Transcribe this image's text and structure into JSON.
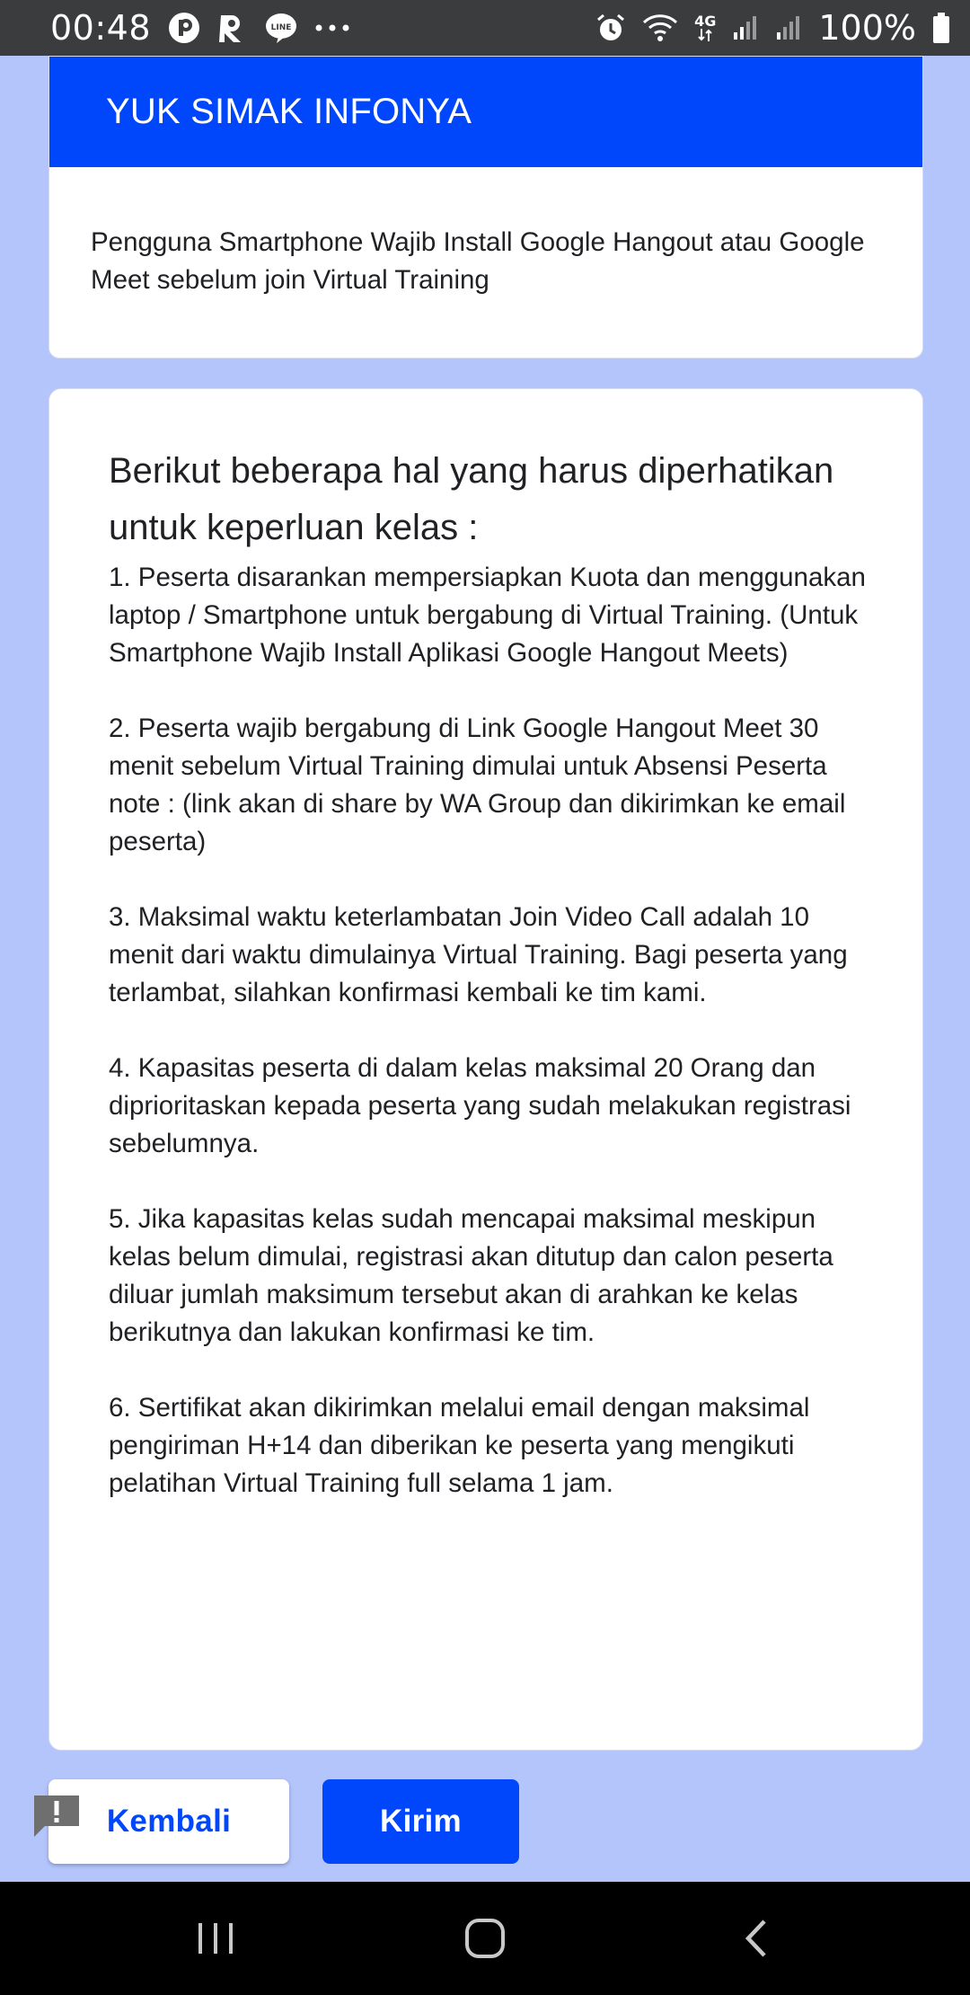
{
  "status_bar": {
    "time": "00:48",
    "network": "4G",
    "battery": "100%",
    "notification_icons": [
      "p-app-icon",
      "r-app-icon",
      "line-icon",
      "more-dots-icon"
    ],
    "system_icons": [
      "alarm-icon",
      "wifi-icon",
      "signal-icon",
      "signal-icon",
      "battery-icon"
    ]
  },
  "header": {
    "title": "YUK SIMAK INFONYA",
    "description": "Pengguna Smartphone Wajib Install Google Hangout atau Google Meet sebelum join Virtual Training"
  },
  "info": {
    "title": "Berikut beberapa hal yang harus diperhatikan untuk keperluan kelas :",
    "body": "1. Peserta disarankan mempersiapkan Kuota dan menggunakan laptop / Smartphone untuk bergabung di Virtual Training. (Untuk Smartphone Wajib Install Aplikasi Google Hangout Meets)\n\n2. Peserta wajib bergabung di Link Google Hangout Meet 30 menit sebelum Virtual Training dimulai untuk Absensi Peserta\nnote : (link akan di share by WA Group dan dikirimkan ke email peserta)\n\n3. Maksimal waktu keterlambatan Join Video Call adalah 10 menit dari waktu dimulainya Virtual Training. Bagi peserta yang terlambat, silahkan konfirmasi kembali ke tim kami.\n\n4. Kapasitas peserta di dalam kelas maksimal 20 Orang dan diprioritaskan kepada peserta yang sudah melakukan registrasi sebelumnya.\n\n5. Jika kapasitas kelas sudah mencapai maksimal meskipun kelas belum dimulai, registrasi akan ditutup dan calon peserta diluar jumlah maksimum tersebut akan di arahkan ke kelas berikutnya dan lakukan konfirmasi ke tim.\n\n6. Sertifikat akan dikirimkan melalui email dengan maksimal pengiriman H+14 dan diberikan ke peserta yang mengikuti pelatihan Virtual Training full selama 1 jam."
  },
  "buttons": {
    "back_label": "Kembali",
    "submit_label": "Kirim"
  },
  "colors": {
    "accent": "#0046fb",
    "background": "#b4c5fb",
    "status_bar": "#3b3c3e"
  }
}
